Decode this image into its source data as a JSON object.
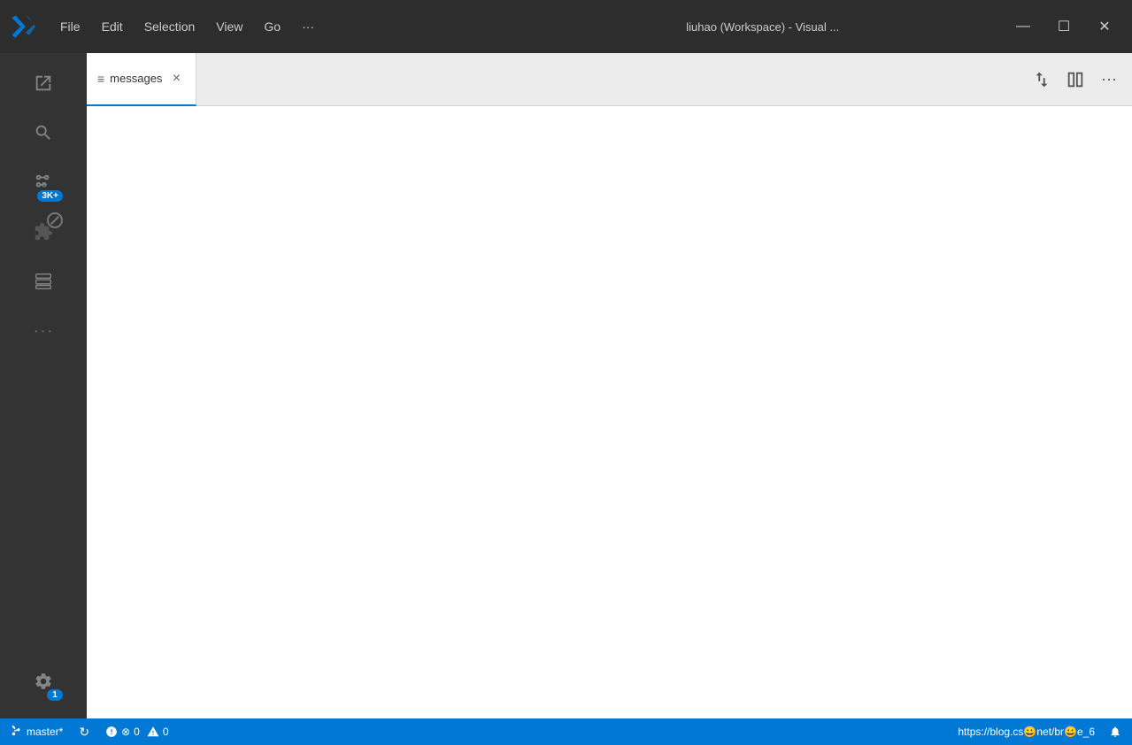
{
  "titlebar": {
    "menu_items": [
      "File",
      "Edit",
      "Selection",
      "View",
      "Go",
      "···"
    ],
    "title": "liuhao (Workspace) - Visual ...",
    "controls": {
      "minimize": "—",
      "maximize": "☐",
      "close": "✕"
    }
  },
  "tab": {
    "label": "messages",
    "hamburger_icon": "≡",
    "close_icon": "×"
  },
  "tab_actions": {
    "split_icon": "⇄",
    "layout_icon": "⧉",
    "more_icon": "···"
  },
  "activity_bar": {
    "icons": [
      {
        "name": "explorer",
        "badge": null
      },
      {
        "name": "search",
        "badge": null
      },
      {
        "name": "source-control",
        "badge": "3K+"
      },
      {
        "name": "extensions",
        "badge": null
      },
      {
        "name": "remote",
        "badge": null
      },
      {
        "name": "more",
        "badge": null
      }
    ],
    "bottom": {
      "settings_badge": "1"
    }
  },
  "status_bar": {
    "branch": "master*",
    "sync_icon": "↻",
    "errors": "0",
    "warnings": "0",
    "url": "https://blog.cs😀net/br😀e_6"
  }
}
